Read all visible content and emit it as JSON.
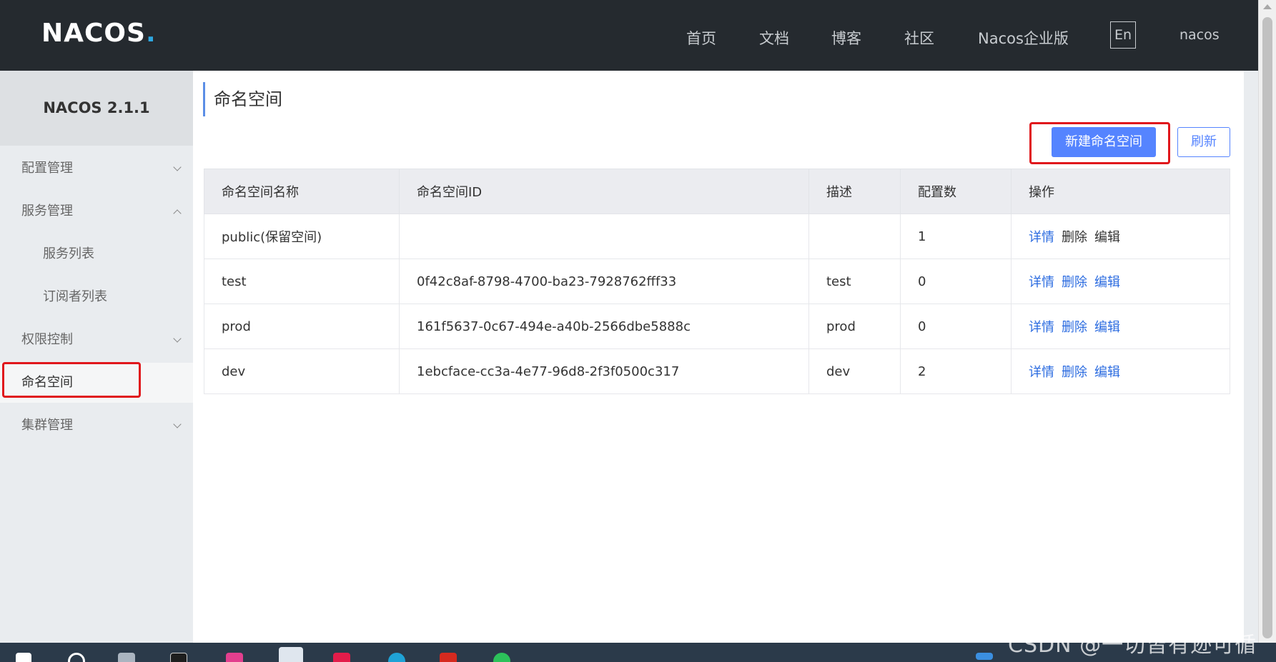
{
  "topbar": {
    "logo_text": "NACOS",
    "nav": [
      "首页",
      "文档",
      "博客",
      "社区",
      "Nacos企业版"
    ],
    "lang": "En",
    "user": "nacos"
  },
  "sidebar": {
    "version": "NACOS 2.1.1",
    "items": [
      {
        "label": "配置管理"
      },
      {
        "label": "服务管理"
      },
      {
        "label": "服务列表"
      },
      {
        "label": "订阅者列表"
      },
      {
        "label": "权限控制"
      },
      {
        "label": "命名空间"
      },
      {
        "label": "集群管理"
      }
    ]
  },
  "main": {
    "title": "命名空间",
    "new_button": "新建命名空间",
    "refresh_button": "刷新",
    "table": {
      "headers": [
        "命名空间名称",
        "命名空间ID",
        "描述",
        "配置数",
        "操作"
      ],
      "rows": [
        {
          "name": "public(保留空间)",
          "id": "",
          "desc": "",
          "count": "1",
          "ops": [
            "详情",
            "删除",
            "编辑"
          ]
        },
        {
          "name": "test",
          "id": "0f42c8af-8798-4700-ba23-7928762fff33",
          "desc": "test",
          "count": "0",
          "ops": [
            "详情",
            "删除",
            "编辑"
          ]
        },
        {
          "name": "prod",
          "id": "161f5637-0c67-494e-a40b-2566dbe5888c",
          "desc": "prod",
          "count": "0",
          "ops": [
            "详情",
            "删除",
            "编辑"
          ]
        },
        {
          "name": "dev",
          "id": "1ebcface-cc3a-4e77-96d8-2f3f0500c317",
          "desc": "dev",
          "count": "2",
          "ops": [
            "详情",
            "删除",
            "编辑"
          ]
        }
      ]
    }
  },
  "watermark": "CSDN @一切皆有迹可循",
  "colors": {
    "topbar": "#252a2f",
    "primary": "#5584ff",
    "link": "#2c6ce0",
    "highlight": "#e0171c"
  }
}
